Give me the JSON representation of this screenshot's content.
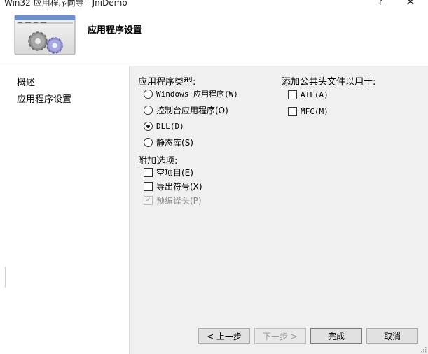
{
  "window": {
    "title": "Win32 应用程序向导 - JniDemo",
    "help_glyph": "?",
    "close_glyph": "✕"
  },
  "header": {
    "title": "应用程序设置",
    "banner_icon": "gears-icon"
  },
  "nav": {
    "items": [
      {
        "label": "概述"
      },
      {
        "label": "应用程序设置"
      }
    ]
  },
  "app_type": {
    "label": "应用程序类型:",
    "options": [
      {
        "text": "Windows 应用程序(W)",
        "selected": false
      },
      {
        "text": "控制台应用程序(O)",
        "selected": false
      },
      {
        "text": "DLL(D)",
        "selected": true
      },
      {
        "text": "静态库(S)",
        "selected": false
      }
    ]
  },
  "extra": {
    "label": "附加选项:",
    "options": [
      {
        "text": "空项目(E)",
        "checked": false,
        "disabled": false
      },
      {
        "text": "导出符号(X)",
        "checked": false,
        "disabled": false
      },
      {
        "text": "预编译头(P)",
        "checked": true,
        "disabled": true
      }
    ]
  },
  "headers": {
    "label": "添加公共头文件以用于:",
    "options": [
      {
        "text": "ATL(A)",
        "checked": false
      },
      {
        "text": "MFC(M)",
        "checked": false
      }
    ]
  },
  "buttons": {
    "back": "< 上一步",
    "next": "下一步 >",
    "finish": "完成",
    "cancel": "取消"
  },
  "colors": {
    "dialog_bg": "#f0f0f0",
    "panel_bg": "#ffffff",
    "disabled_text": "#8c8c8c"
  }
}
